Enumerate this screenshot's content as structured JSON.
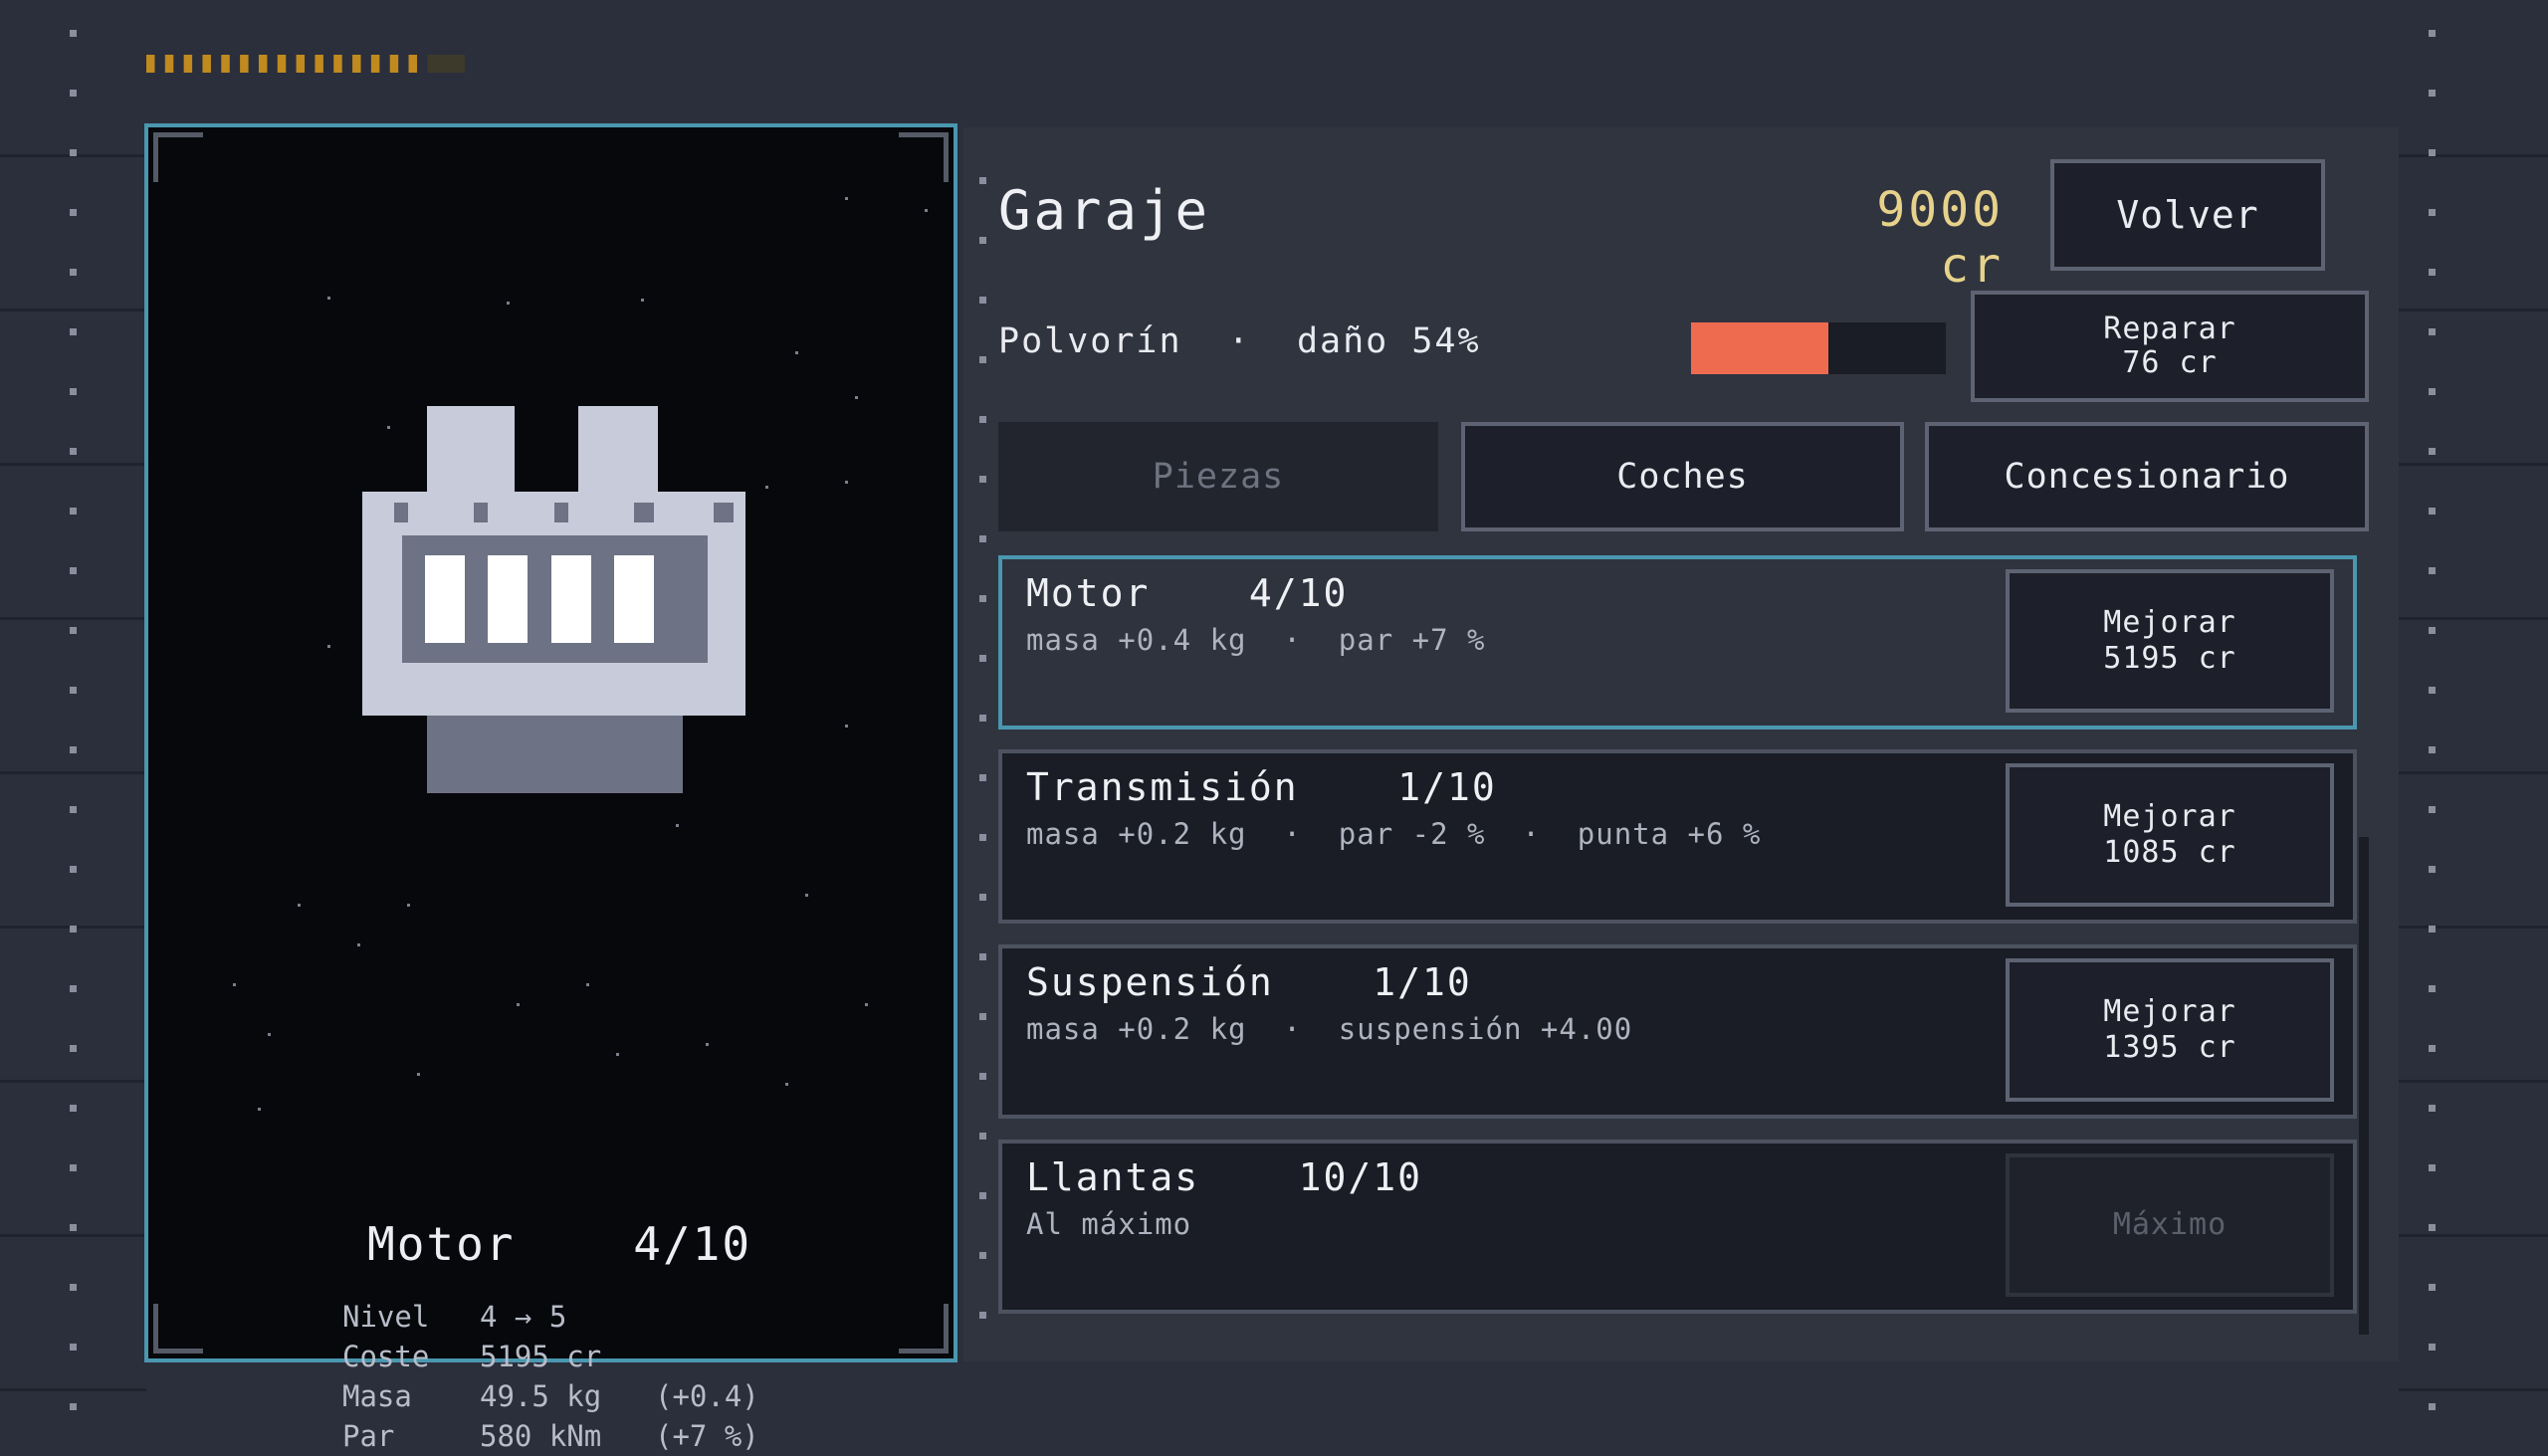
{
  "screen": {
    "title": "Garaje",
    "credits": "9000 cr",
    "back_label": "Volver"
  },
  "vehicle": {
    "name": "Polvorín",
    "separator": "·",
    "damage_text": "daño 54%",
    "damage_fraction": 0.54,
    "repair_label": "Reparar",
    "repair_cost": "76 cr"
  },
  "tabs": [
    {
      "label": "Piezas",
      "active": true
    },
    {
      "label": "Coches",
      "active": false
    },
    {
      "label": "Concesionario",
      "active": false
    }
  ],
  "parts": [
    {
      "name": "Motor",
      "level": "4/10",
      "stats": "masa +0.4 kg  ·  par +7 %",
      "button_label": "Mejorar",
      "button_cost": "5195 cr",
      "selected": true
    },
    {
      "name": "Transmisión",
      "level": "1/10",
      "stats": "masa +0.2 kg  ·  par -2 %  ·  punta +6 %",
      "button_label": "Mejorar",
      "button_cost": "1085 cr",
      "selected": false
    },
    {
      "name": "Suspensión",
      "level": "1/10",
      "stats": "masa +0.2 kg  ·  suspensión +4.00",
      "button_label": "Mejorar",
      "button_cost": "1395 cr",
      "selected": false
    },
    {
      "name": "Llantas",
      "level": "10/10",
      "stats": "Al máximo",
      "button_label": "Máximo",
      "button_cost": "",
      "selected": false,
      "maxed": true
    }
  ],
  "preview": {
    "name": "Motor",
    "level": "4/10",
    "icon": "engine-icon",
    "stats": [
      {
        "key": "Nivel",
        "value": "4 → 5",
        "delta": ""
      },
      {
        "key": "Coste",
        "value": "5195 cr",
        "delta": ""
      },
      {
        "key": "Masa",
        "value": "49.5 kg",
        "delta": "(+0.4)"
      },
      {
        "key": "Par",
        "value": "580 kNm",
        "delta": "(+7 %)"
      }
    ]
  },
  "colors": {
    "accent": "#4a97b0",
    "credits": "#e6d28a",
    "damage": "#ee6b50",
    "progress_dash": "#c08a1f"
  },
  "top_progress": {
    "filled": 15,
    "total": 17
  }
}
